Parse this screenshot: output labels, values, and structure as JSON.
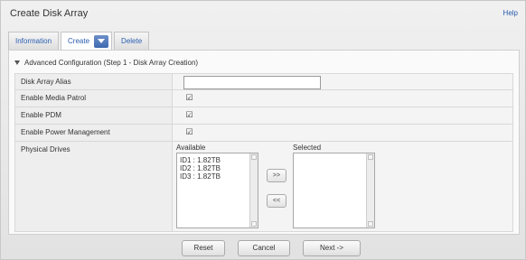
{
  "window": {
    "title": "Create Disk Array",
    "help_label": "Help"
  },
  "tabs": [
    {
      "label": "Information"
    },
    {
      "label": "Create"
    },
    {
      "label": "Delete"
    }
  ],
  "section": {
    "title": "Advanced Configuration (Step 1 - Disk Array Creation)"
  },
  "form": {
    "alias": {
      "label": "Disk Array Alias",
      "value": ""
    },
    "media_patrol": {
      "label": "Enable Media Patrol",
      "checked": true
    },
    "pdm": {
      "label": "Enable PDM",
      "checked": true
    },
    "power_mgmt": {
      "label": "Enable Power Management",
      "checked": true
    },
    "physical_drives": {
      "label": "Physical Drives",
      "available_label": "Available",
      "selected_label": "Selected",
      "available": [
        "ID1 : 1.82TB",
        "ID2 : 1.82TB",
        "ID3 : 1.82TB"
      ],
      "selected": [],
      "add_label": ">>",
      "remove_label": "<<"
    }
  },
  "footer": {
    "reset_label": "Reset",
    "cancel_label": "Cancel",
    "next_label": "Next ->"
  },
  "check_glyph": "☑"
}
